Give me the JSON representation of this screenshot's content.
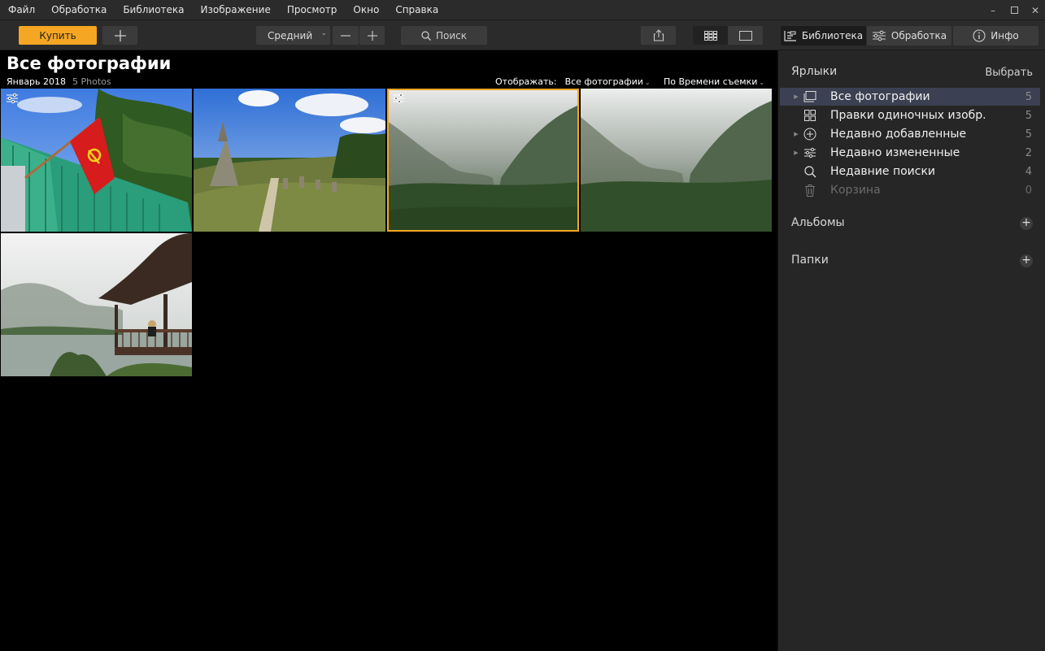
{
  "menu": {
    "items": [
      "Файл",
      "Обработка",
      "Библиотека",
      "Изображение",
      "Просмотр",
      "Окно",
      "Справка"
    ]
  },
  "toolbar": {
    "buy_label": "Купить",
    "size_label": "Средний",
    "search_label": "Поиск",
    "tab_library": "Библиотека",
    "tab_edit": "Обработка",
    "tab_info": "Инфо"
  },
  "main": {
    "title": "Все фотографии",
    "date": "Январь 2018",
    "count": "5 Photos",
    "filter_label": "Отображать:",
    "filter_value": "Все фотографии",
    "sort_value": "По Времени съемки"
  },
  "sidebar": {
    "labels_header": "Ярлыки",
    "select_label": "Выбрать",
    "items": [
      {
        "label": "Все фотографии",
        "count": "5",
        "icon": "photos-icon",
        "active": true
      },
      {
        "label": "Правки одиночных изобр.",
        "count": "5",
        "icon": "grid-edits-icon"
      },
      {
        "label": "Недавно добавленные",
        "count": "5",
        "icon": "plus-circle-icon"
      },
      {
        "label": "Недавно измененные",
        "count": "2",
        "icon": "sliders-icon"
      },
      {
        "label": "Недавние поиски",
        "count": "4",
        "icon": "search-icon"
      },
      {
        "label": "Корзина",
        "count": "0",
        "icon": "trash-icon"
      }
    ],
    "albums_header": "Альбомы",
    "folders_header": "Папки"
  },
  "colors": {
    "accent": "#f5a623",
    "active_row": "#3b4052"
  }
}
